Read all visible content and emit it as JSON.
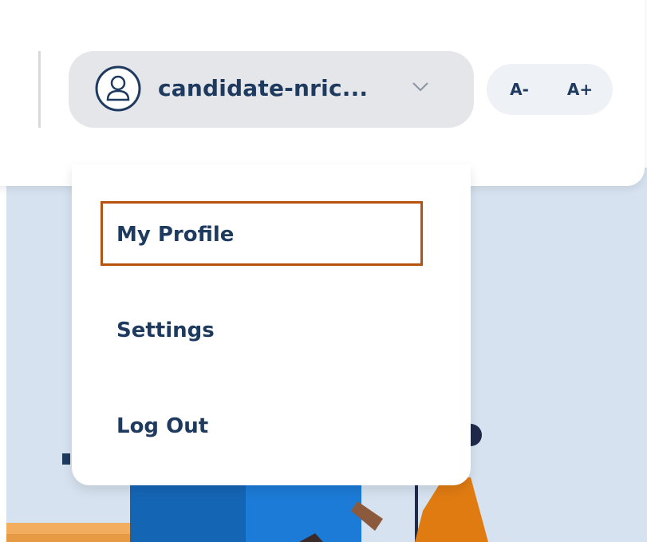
{
  "user_menu": {
    "username": "candidate-nric...",
    "avatar_icon": "user-icon",
    "chevron_icon": "chevron-down-icon"
  },
  "font_controls": {
    "decrease_label": "A-",
    "increase_label": "A+"
  },
  "dropdown": {
    "items": [
      {
        "label": "My Profile",
        "highlighted": true
      },
      {
        "label": "Settings",
        "highlighted": false
      },
      {
        "label": "Log Out",
        "highlighted": false
      }
    ]
  },
  "colors": {
    "text": "#1f3a5f",
    "highlight_border": "#b5520f",
    "background_region": "#d6e2ef",
    "trigger_bg": "#e5e6ea"
  }
}
